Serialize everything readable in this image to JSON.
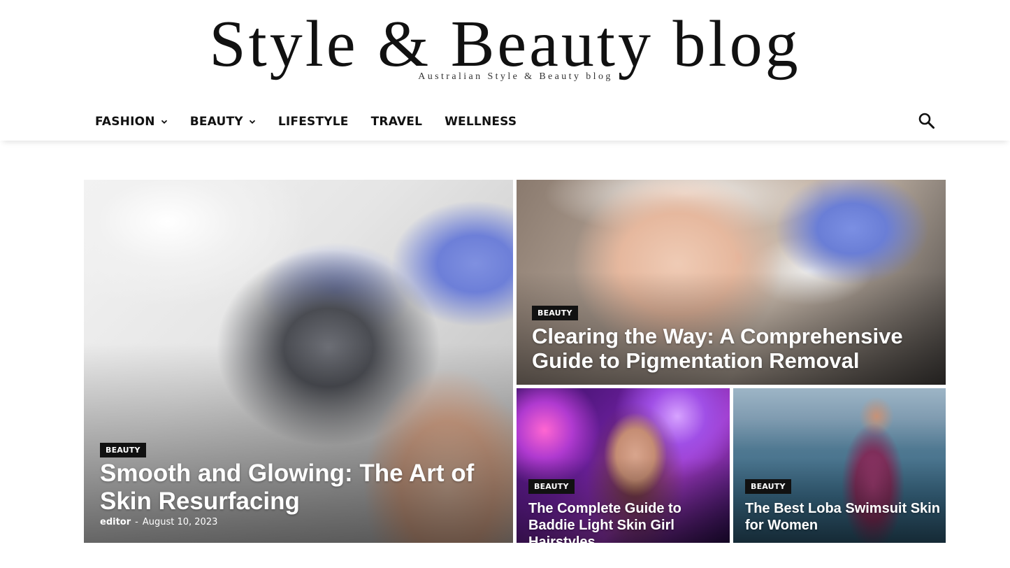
{
  "site": {
    "title": "Style & Beauty blog",
    "tagline": "Australian Style & Beauty blog"
  },
  "nav": {
    "items": [
      {
        "label": "FASHION",
        "has_dropdown": true
      },
      {
        "label": "BEAUTY",
        "has_dropdown": true
      },
      {
        "label": "LIFESTYLE",
        "has_dropdown": false
      },
      {
        "label": "TRAVEL",
        "has_dropdown": false
      },
      {
        "label": "WELLNESS",
        "has_dropdown": false
      }
    ],
    "search_icon": "search-icon"
  },
  "featured": {
    "main": {
      "category": "BEAUTY",
      "title": "Smooth and Glowing: The Art of Skin Resurfacing",
      "author": "editor",
      "separator": "-",
      "date": "August 10, 2023"
    },
    "top_right": {
      "category": "BEAUTY",
      "title": "Clearing the Way: A Comprehensive Guide to Pigmentation Removal"
    },
    "bottom_left": {
      "category": "BEAUTY",
      "title": "The Complete Guide to Baddie Light Skin Girl Hairstyles"
    },
    "bottom_right": {
      "category": "BEAUTY",
      "title": "The Best Loba Swimsuit Skin for Women"
    }
  },
  "colors": {
    "badge_bg": "#111111",
    "text_dark": "#111111",
    "glove_blue": "#6d7fd8"
  }
}
